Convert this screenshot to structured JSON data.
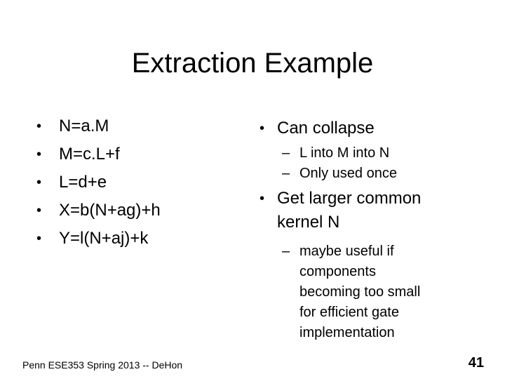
{
  "slide": {
    "title": "Extraction Example",
    "left_bullets": [
      "N=a.M",
      "M=c.L+f",
      "L=d+e",
      "X=b(N+ag)+h",
      "Y=l(N+aj)+k"
    ],
    "right": {
      "main1": "Can collapse",
      "sub1": [
        "L into M into N",
        "Only used once"
      ],
      "main2_line1": "Get larger common",
      "main2_line2": "kernel N",
      "sub2_lines": [
        "maybe useful if",
        "components",
        "becoming too small",
        "for efficient gate",
        "implementation"
      ]
    },
    "bullet_glyph": "•",
    "dash_glyph": "–",
    "footer": "Penn ESE353 Spring 2013 -- DeHon",
    "page_number": "41"
  }
}
